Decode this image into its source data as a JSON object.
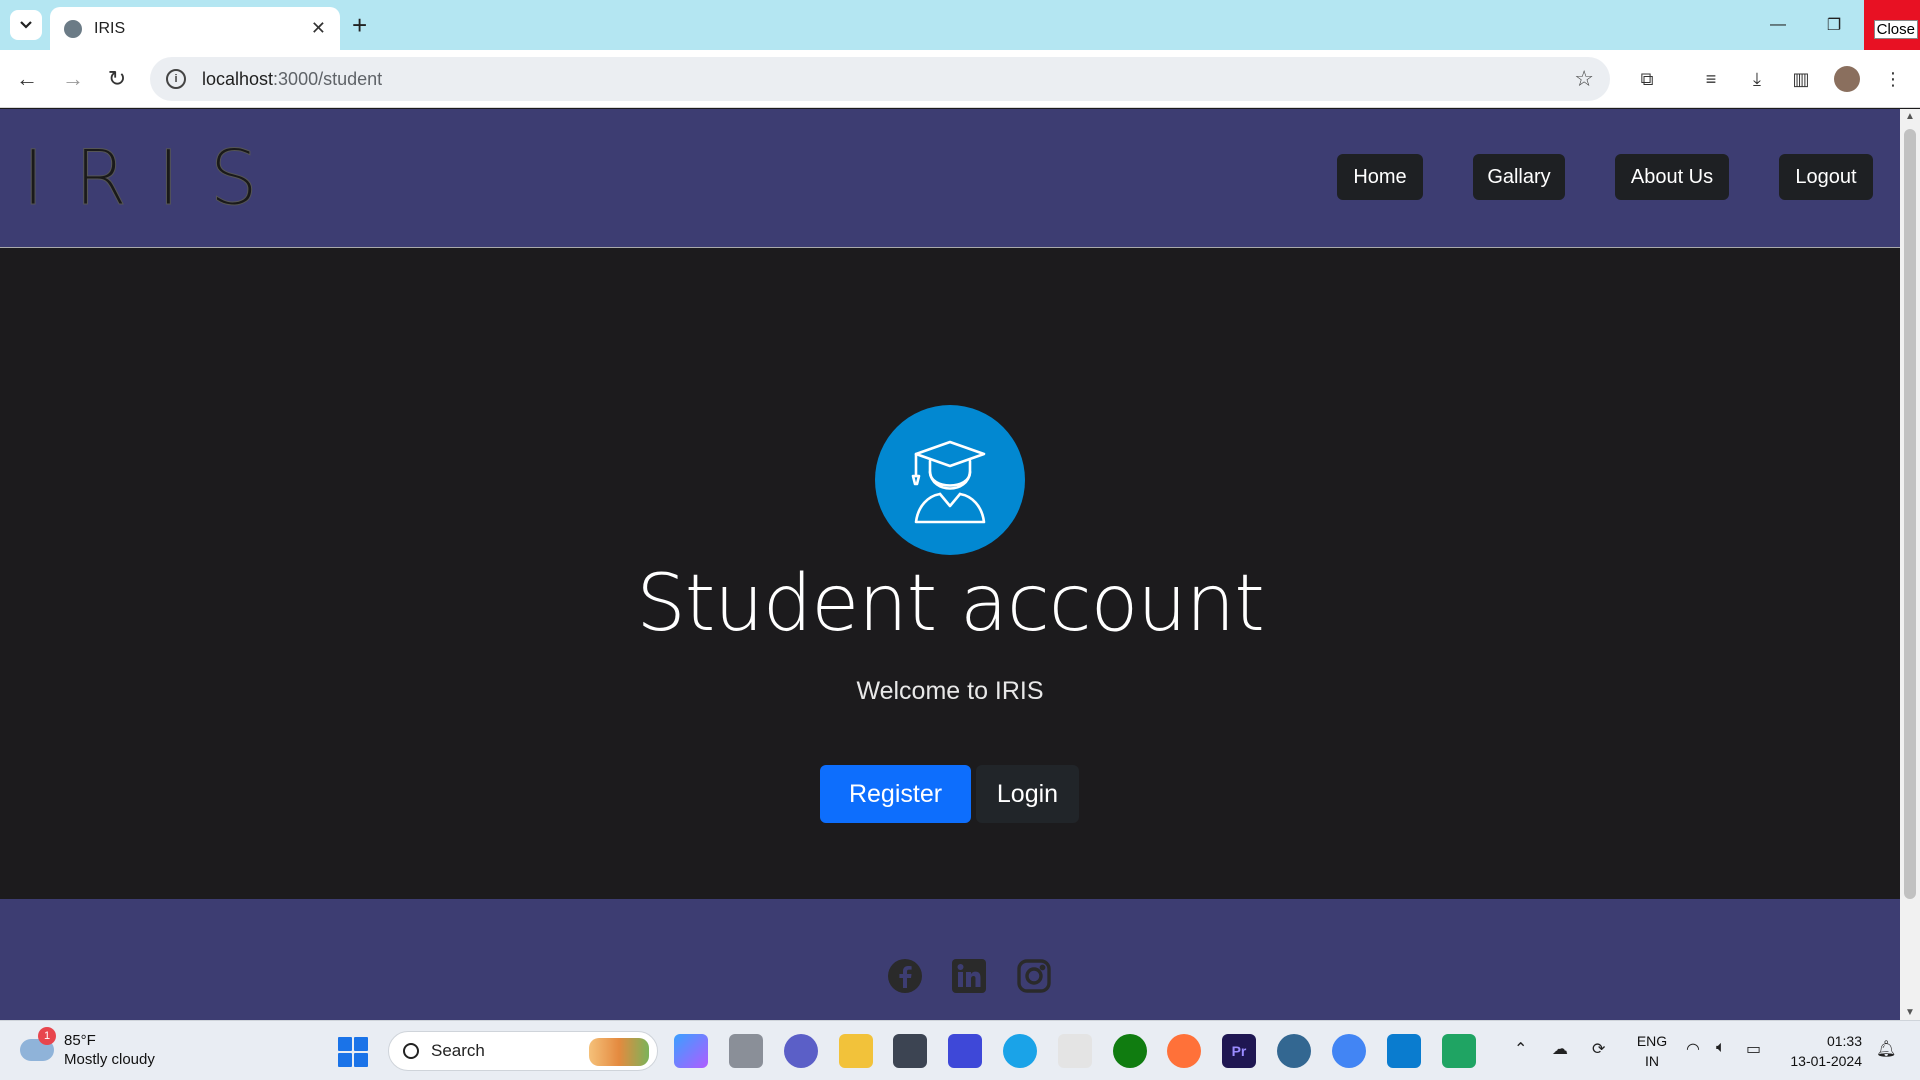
{
  "browser": {
    "tab_title": "IRIS",
    "url_host": "localhost",
    "url_rest": ":3000/student",
    "close_label": "Close"
  },
  "site": {
    "logo": "IRIS",
    "nav": [
      {
        "label": "Home"
      },
      {
        "label": "Gallary"
      },
      {
        "label": "About Us"
      },
      {
        "label": "Logout"
      }
    ]
  },
  "hero": {
    "title": "Student account",
    "subtitle": "Welcome to IRIS",
    "register_label": "Register",
    "login_label": "Login"
  },
  "footer": {
    "social_icons": [
      "facebook-icon",
      "linkedin-icon",
      "instagram-icon"
    ]
  },
  "taskbar": {
    "weather_badge": "1",
    "temperature": "85°F",
    "condition": "Mostly cloudy",
    "search_label": "Search",
    "lang_line1": "ENG",
    "lang_line2": "IN",
    "time": "01:33",
    "date": "13-01-2024"
  },
  "colors": {
    "header_bg": "#3d3d72",
    "page_bg": "#1c1b1d",
    "register_bg": "#0d6efd",
    "icon_circle": "#0288d1"
  }
}
